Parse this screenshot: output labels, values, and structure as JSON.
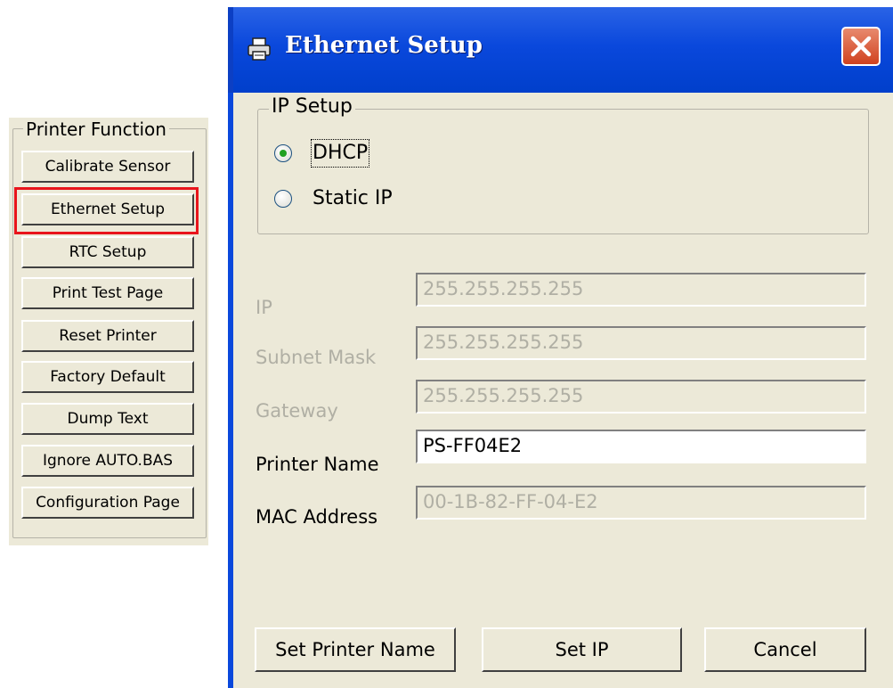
{
  "printer_function": {
    "title": "Printer Function",
    "buttons": [
      "Calibrate Sensor",
      "Ethernet Setup",
      "RTC Setup",
      "Print Test Page",
      "Reset Printer",
      "Factory Default",
      "Dump Text",
      "Ignore AUTO.BAS",
      "Configuration Page"
    ],
    "highlight_color": "#e8141c"
  },
  "dialog": {
    "title": "Ethernet Setup",
    "title_icon": "printer-icon",
    "close_icon": "close-icon",
    "ip_setup": {
      "legend": "IP Setup",
      "dhcp_label": "DHCP",
      "static_label": "Static IP",
      "selected": "DHCP"
    },
    "fields": {
      "ip_label": "IP",
      "ip_value": "255.255.255.255",
      "subnet_label": "Subnet Mask",
      "subnet_value": "255.255.255.255",
      "gateway_label": "Gateway",
      "gateway_value": "255.255.255.255",
      "printer_name_label": "Printer Name",
      "printer_name_value": "PS-FF04E2",
      "mac_label": "MAC Address",
      "mac_value": "00-1B-82-FF-04-E2"
    },
    "buttons": {
      "set_printer_name": "Set Printer Name",
      "set_ip": "Set IP",
      "cancel": "Cancel"
    },
    "colors": {
      "titlebar": "#0a48dc",
      "close_button": "#d0421f",
      "dialog_face": "#ece9d8"
    }
  }
}
